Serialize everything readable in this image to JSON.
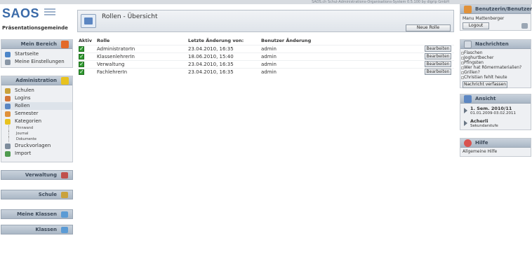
{
  "system_line": "SAOS.ch Schul-Administrations-Organisations-System 0.5.100 by digrip GmbH",
  "logo": "SAOS",
  "school_name": "Präsentationsgemeinde",
  "left": {
    "mein_bereich": {
      "title": "Mein Bereich",
      "items": [
        "Startseite",
        "Meine Einstellungen"
      ]
    },
    "administration": {
      "title": "Administration",
      "items": [
        "Schulen",
        "Logins",
        "Rollen",
        "Semester",
        "Kategorien"
      ],
      "sub_items": [
        "Pinnwand",
        "Journal",
        "Dokumente"
      ],
      "items_after": [
        "Druckvorlagen",
        "Import"
      ]
    },
    "bars": [
      "Verwaltung",
      "Schule",
      "Meine Klassen",
      "Klassen"
    ]
  },
  "main": {
    "title": "Rollen - Übersicht",
    "new_button": "Neue Rolle",
    "columns": [
      "Aktiv",
      "Rolle",
      "Letzte Änderung von:",
      "Benutzer Änderung"
    ],
    "rows": [
      {
        "rolle": "AdministratorIn",
        "datum": "23.04.2010, 16:35",
        "benutzer": "admin"
      },
      {
        "rolle": "KlassenlehrerIn",
        "datum": "18.06.2010, 15:40",
        "benutzer": "admin"
      },
      {
        "rolle": "Verwaltung",
        "datum": "23.04.2010, 16:35",
        "benutzer": "admin"
      },
      {
        "rolle": "FachlehrerIn",
        "datum": "23.04.2010, 16:35",
        "benutzer": "admin"
      }
    ],
    "edit_button": "Bearbeiten"
  },
  "right": {
    "user": {
      "title": "Benutzerin/Benutzer",
      "name": "Manu Mattenberger",
      "logout": "Logout"
    },
    "messages": {
      "title": "Nachrichten",
      "items": [
        "Flaschen",
        "Joghurtbecher",
        "Pfingsten",
        "Wer hat Römermaterialien?",
        "Grillen?",
        "Christian fehlt heute"
      ],
      "compose": "Nachricht verfassen"
    },
    "view": {
      "title": "Ansicht",
      "items": [
        {
          "a": "1. Sem. 2010/11",
          "b": "01.01.2009-03.02.2011"
        },
        {
          "a": "Acherli",
          "b": "Sekundarstufe"
        }
      ]
    },
    "help": {
      "title": "Hilfe",
      "text": "Allgemeine Hilfe"
    }
  }
}
